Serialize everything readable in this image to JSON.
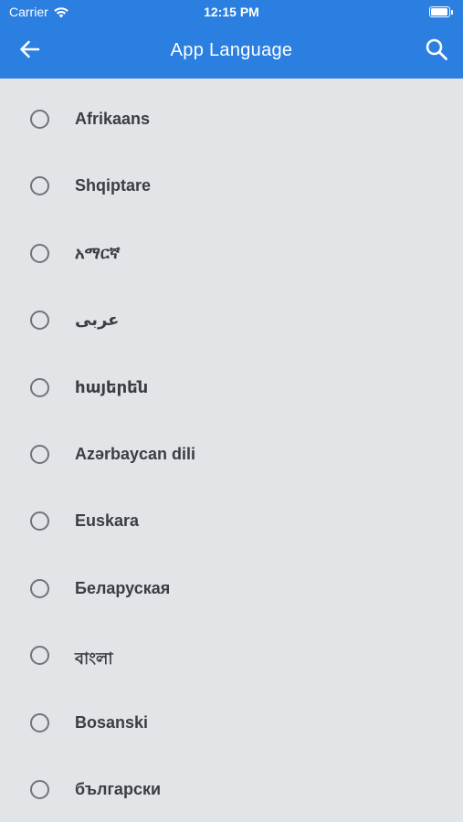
{
  "status_bar": {
    "carrier": "Carrier",
    "time": "12:15 PM",
    "wifi_icon": "wifi-icon",
    "battery_icon": "battery-icon"
  },
  "header": {
    "title": "App Language",
    "back_icon": "arrow-left-icon",
    "search_icon": "search-icon",
    "background_color": "#2a7fe0"
  },
  "languages": [
    {
      "label": "Afrikaans",
      "selected": false
    },
    {
      "label": "Shqiptare",
      "selected": false
    },
    {
      "label": "አማርኛ",
      "selected": false
    },
    {
      "label": "عربى",
      "selected": false
    },
    {
      "label": "հայերեն",
      "selected": false
    },
    {
      "label": "Azərbaycan dili",
      "selected": false
    },
    {
      "label": "Euskara",
      "selected": false
    },
    {
      "label": "Беларуская",
      "selected": false
    },
    {
      "label": "বাংলা",
      "selected": false
    },
    {
      "label": "Bosanski",
      "selected": false
    },
    {
      "label": "български",
      "selected": false
    }
  ],
  "colors": {
    "list_background": "#e1e5e8",
    "radio_border": "#707479",
    "label_text": "#3a3d41"
  }
}
